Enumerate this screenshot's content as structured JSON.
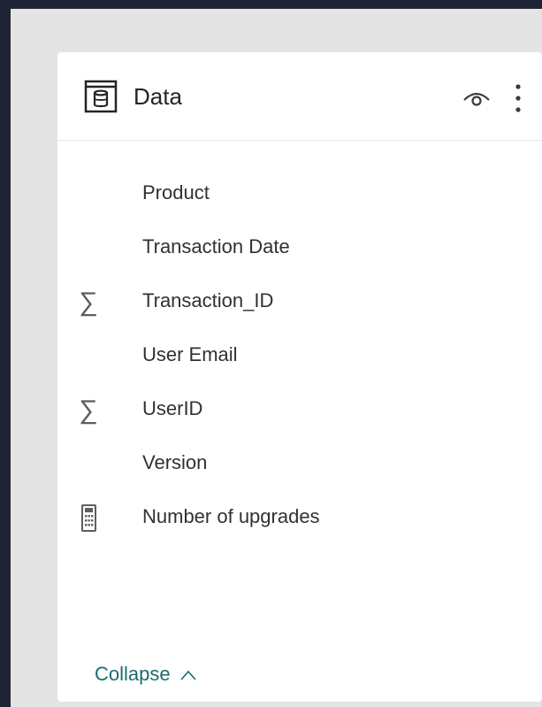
{
  "panel": {
    "title": "Data",
    "title_icon": "database-table-icon",
    "header_actions": [
      "eye-icon",
      "more-options-icon"
    ]
  },
  "fields": [
    {
      "label": "Product",
      "icon": ""
    },
    {
      "label": "Transaction Date",
      "icon": ""
    },
    {
      "label": "Transaction_ID",
      "icon": "sigma-icon"
    },
    {
      "label": "User Email",
      "icon": ""
    },
    {
      "label": "UserID",
      "icon": "sigma-icon"
    },
    {
      "label": "Version",
      "icon": ""
    },
    {
      "label": "Number of upgrades",
      "icon": "calculator-icon"
    }
  ],
  "footer": {
    "collapse_label": "Collapse"
  },
  "colors": {
    "background": "#1e2433",
    "frame": "#e4e4e4",
    "card": "#ffffff",
    "text": "#323130",
    "link": "#1c6b6e"
  }
}
